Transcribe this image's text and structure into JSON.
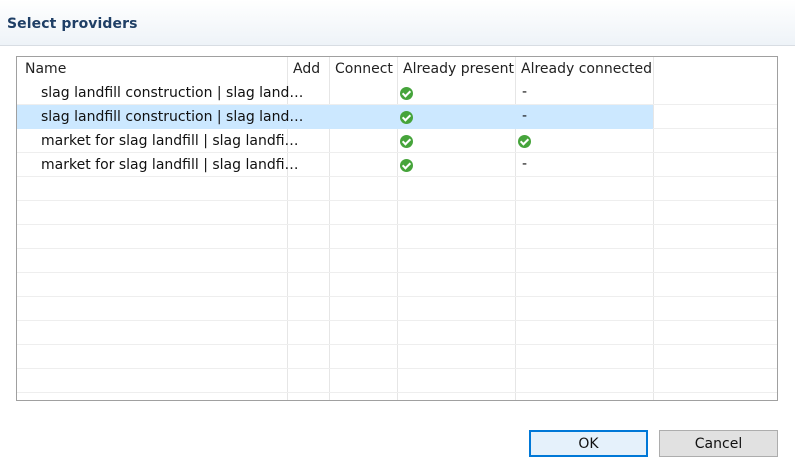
{
  "dialog": {
    "title": "Select providers"
  },
  "table": {
    "columns": [
      "Name",
      "Add",
      "Connect",
      "Already present",
      "Already connected"
    ],
    "rows": [
      {
        "name": "slag landfill construction | slag land…",
        "add": "",
        "connect": "",
        "already_present": "check-icon",
        "already_connected": "-"
      },
      {
        "name": "slag landfill construction | slag land…",
        "add": "",
        "connect": "",
        "already_present": "check-icon",
        "already_connected": "-",
        "selected": true
      },
      {
        "name": "market for slag landfill | slag landfi…",
        "add": "",
        "connect": "",
        "already_present": "check-icon",
        "already_connected": "check-icon"
      },
      {
        "name": "market for slag landfill | slag landfi…",
        "add": "",
        "connect": "",
        "already_present": "check-icon",
        "already_connected": "-"
      }
    ]
  },
  "buttons": {
    "ok": "OK",
    "cancel": "Cancel"
  },
  "colors": {
    "title": "#1f3f66",
    "selected_row": "#cce8ff",
    "check": "#46a43b",
    "ok_border": "#0078d7"
  }
}
